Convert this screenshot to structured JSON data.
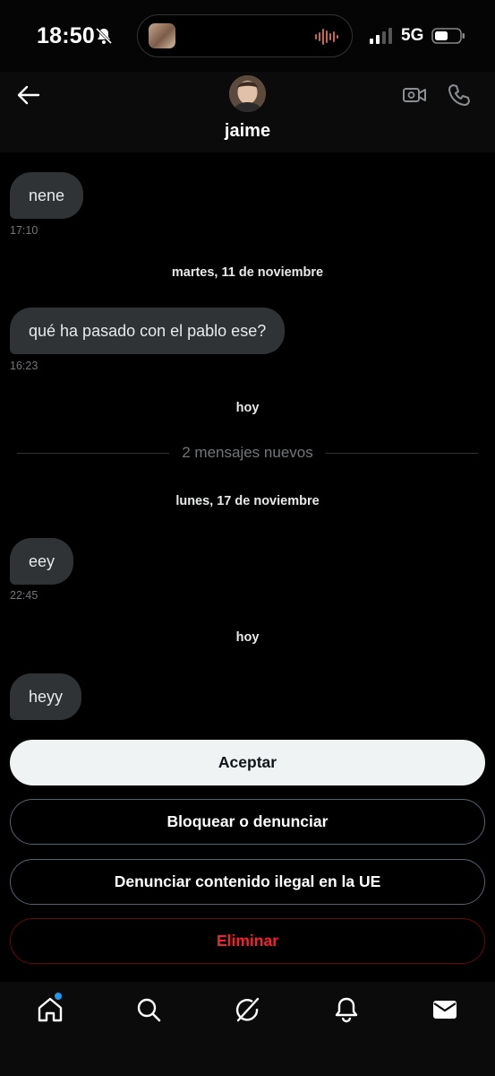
{
  "status_bar": {
    "time": "18:50",
    "network": "5G",
    "icons": [
      "bell-muted-icon",
      "audio-wave-icon",
      "signal-icon",
      "battery-icon"
    ]
  },
  "header": {
    "contact_name": "jaime",
    "icons": [
      "back-arrow-icon",
      "video-call-icon",
      "phone-call-icon"
    ]
  },
  "messages": [
    {
      "text": "nene",
      "time": "17:10"
    },
    {
      "separator": "martes, 11 de noviembre"
    },
    {
      "text": "qué ha pasado con el pablo ese?",
      "time": "16:23"
    },
    {
      "separator": "hoy"
    },
    {
      "new_messages": "2 mensajes nuevos"
    },
    {
      "separator": "lunes, 17 de noviembre"
    },
    {
      "text": "eey",
      "time": "22:45"
    },
    {
      "separator": "hoy"
    },
    {
      "text": "heyy"
    }
  ],
  "actions": {
    "accept": "Aceptar",
    "block_report": "Bloquear o denunciar",
    "report_illegal": "Denunciar contenido ilegal en la UE",
    "delete": "Eliminar"
  },
  "bottom_nav": {
    "items": [
      "home-icon",
      "search-icon",
      "grok-icon",
      "notifications-icon",
      "messages-icon"
    ],
    "home_has_badge": true
  },
  "colors": {
    "background": "#000000",
    "bubble": "#2f3336",
    "accent": "#1d9bf0",
    "danger": "#f4212e"
  }
}
